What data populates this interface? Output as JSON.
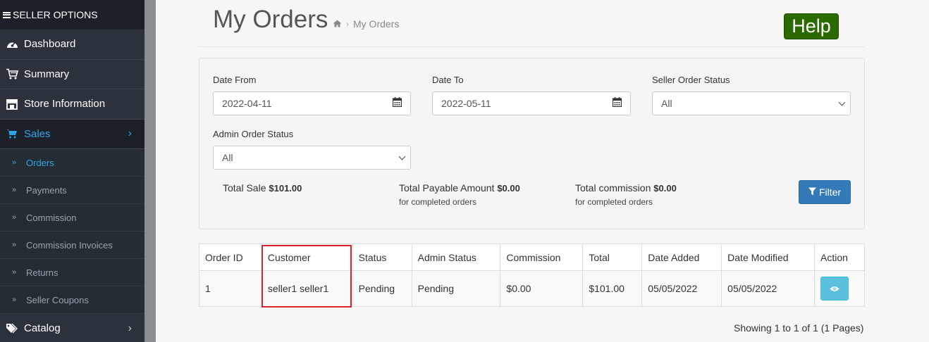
{
  "sidebar": {
    "header": "SELLER OPTIONS",
    "items": [
      {
        "label": "Dashboard",
        "icon": "dashboard-icon"
      },
      {
        "label": "Summary",
        "icon": "cart-icon"
      },
      {
        "label": "Store Information",
        "icon": "store-icon"
      },
      {
        "label": "Sales",
        "icon": "cart-icon",
        "active": true
      }
    ],
    "sub_items": [
      {
        "label": "Orders",
        "active": true
      },
      {
        "label": "Payments"
      },
      {
        "label": "Commission"
      },
      {
        "label": "Commission Invoices"
      },
      {
        "label": "Returns"
      },
      {
        "label": "Seller Coupons"
      }
    ],
    "catalog": {
      "label": "Catalog",
      "icon": "tags-icon"
    }
  },
  "page": {
    "title": "My Orders",
    "breadcrumb": "My Orders",
    "help_label": "Help"
  },
  "filter": {
    "date_from_label": "Date From",
    "date_from_value": "2022-04-11",
    "date_to_label": "Date To",
    "date_to_value": "2022-05-11",
    "seller_status_label": "Seller Order Status",
    "seller_status_value": "All",
    "admin_status_label": "Admin Order Status",
    "admin_status_value": "All",
    "total_sale_label": "Total Sale",
    "total_sale_value": "$101.00",
    "payable_label": "Total Payable Amount",
    "payable_value": "$0.00",
    "payable_note": "for completed orders",
    "commission_label": "Total commission",
    "commission_value": "$0.00",
    "commission_note": "for completed orders",
    "filter_button": "Filter"
  },
  "table": {
    "headers": [
      "Order ID",
      "Customer",
      "Status",
      "Admin Status",
      "Commission",
      "Total",
      "Date Added",
      "Date Modified",
      "Action"
    ],
    "rows": [
      {
        "order_id": "1",
        "customer": "seller1 seller1",
        "status": "Pending",
        "admin_status": "Pending",
        "commission": "$0.00",
        "total": "$101.00",
        "date_added": "05/05/2022",
        "date_modified": "05/05/2022"
      }
    ]
  },
  "pagination": "Showing 1 to 1 of 1 (1 Pages)",
  "colors": {
    "sidebar_bg": "#2b323b",
    "accent": "#2fa4e7",
    "help_bg": "#2b6a00",
    "filter_btn": "#337ab7",
    "view_btn": "#5bc0de",
    "highlight": "#d9232d"
  }
}
